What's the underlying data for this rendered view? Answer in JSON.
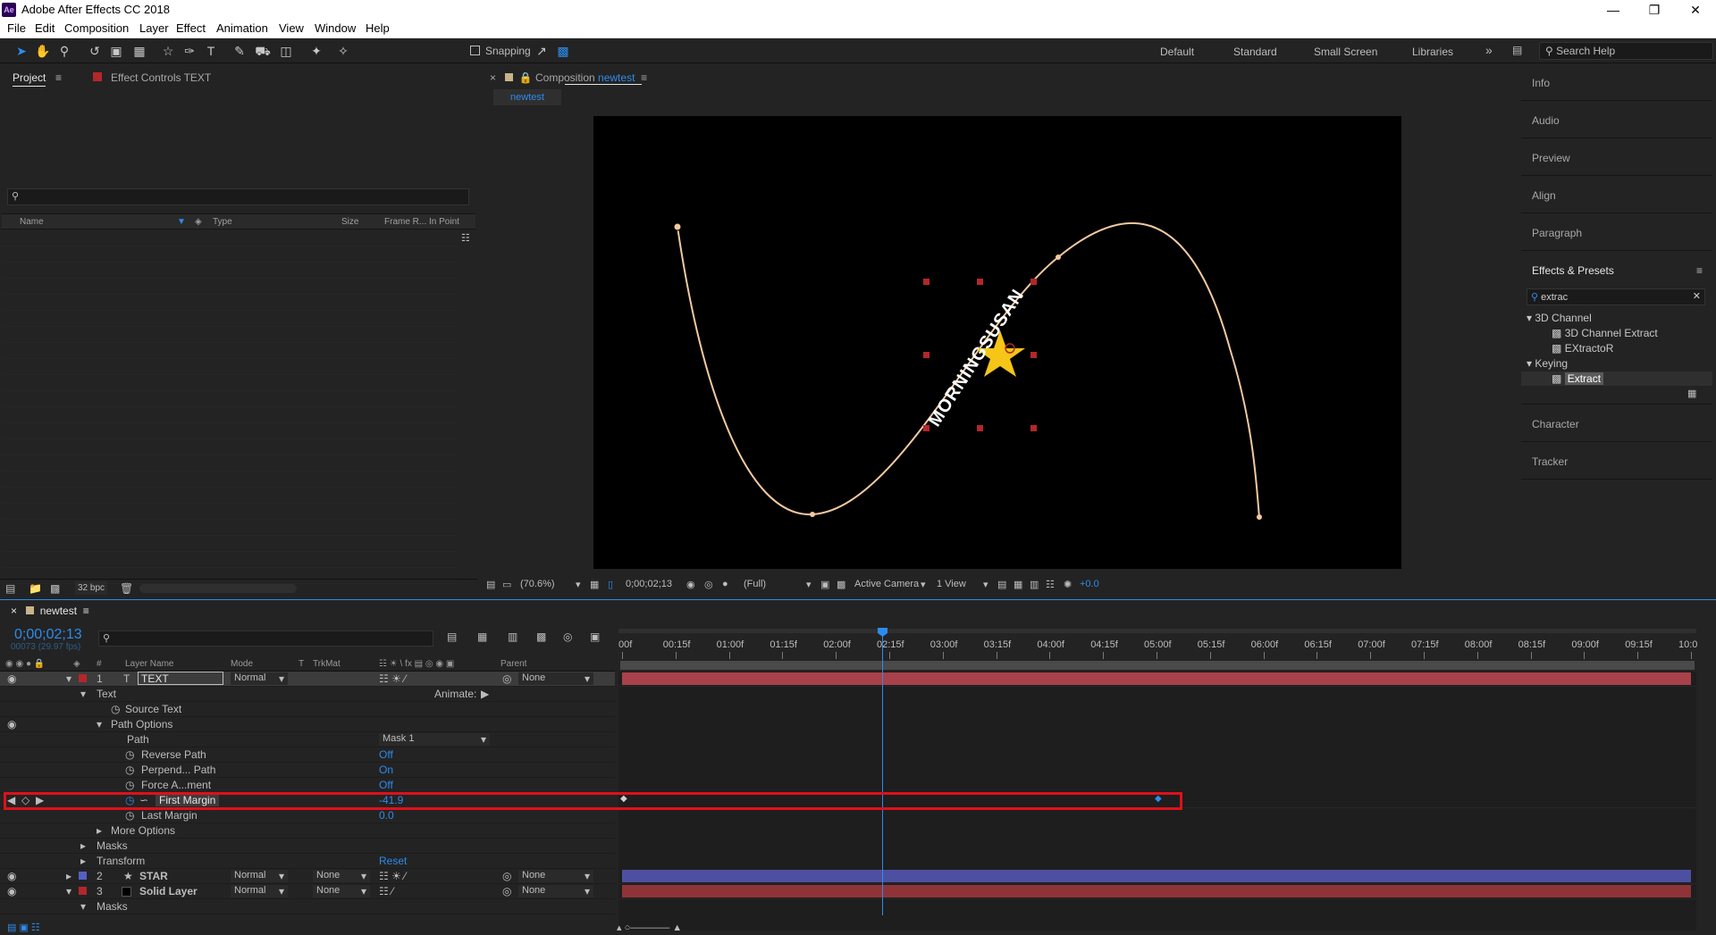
{
  "app": {
    "title": "Adobe After Effects CC 2018",
    "icon_label": "Ae"
  },
  "menu": [
    "File",
    "Edit",
    "Composition",
    "Layer",
    "Effect",
    "Animation",
    "View",
    "Window",
    "Help"
  ],
  "toolbar": {
    "snapping_label": "Snapping",
    "workspaces": [
      "Default",
      "Standard",
      "Small Screen",
      "Libraries"
    ],
    "search_placeholder": "Search Help"
  },
  "project": {
    "tab_project": "Project",
    "tab_effect_controls": "Effect Controls TEXT",
    "columns": [
      "Name",
      "Type",
      "Size",
      "Frame R...",
      "In Point"
    ],
    "bpc": "32 bpc"
  },
  "composition": {
    "tab_label": "Composition",
    "comp_name": "newtest",
    "sub_tab": "newtest",
    "path_text": "MORNINGSUSAN",
    "toolbar": {
      "zoom": "(70.6%)",
      "timecode": "0;00;02;13",
      "resolution": "(Full)",
      "camera": "Active Camera",
      "views": "1 View",
      "exposure": "+0.0"
    }
  },
  "right_panels": {
    "items": [
      "Info",
      "Audio",
      "Preview",
      "Align",
      "Paragraph",
      "Effects & Presets",
      "Character",
      "Tracker"
    ],
    "effects_search": "extrac",
    "tree": [
      {
        "category": "3D Channel",
        "items": [
          "3D Channel Extract",
          "EXtractoR"
        ]
      },
      {
        "category": "Keying",
        "items": [
          "Extract"
        ]
      }
    ]
  },
  "timeline": {
    "tab": "newtest",
    "timecode": "0;00;02;13",
    "frames": "00073 (29.97 fps)",
    "headers": {
      "layer_name": "Layer Name",
      "mode": "Mode",
      "t": "T",
      "trkmat": "TrkMat",
      "parent": "Parent",
      "num": "#"
    },
    "ruler": [
      "00f",
      "00:15f",
      "01:00f",
      "01:15f",
      "02:00f",
      "02:15f",
      "03:00f",
      "03:15f",
      "04:00f",
      "04:15f",
      "05:00f",
      "05:15f",
      "06:00f",
      "06:15f",
      "07:00f",
      "07:15f",
      "08:00f",
      "08:15f",
      "09:00f",
      "09:15f",
      "10:0"
    ],
    "current_frame_position": 2.4333,
    "layers": [
      {
        "num": "1",
        "name": "TEXT",
        "mode": "Normal",
        "trkmat": "",
        "parent": "None",
        "color": "#b3272b"
      },
      {
        "num": "2",
        "name": "STAR",
        "mode": "Normal",
        "trkmat": "None",
        "parent": "None",
        "color": "#5560c4"
      },
      {
        "num": "3",
        "name": "Solid Layer",
        "mode": "Normal",
        "trkmat": "None",
        "parent": "None",
        "color": "#b3272b"
      }
    ],
    "props": {
      "text": "Text",
      "animate": "Animate:",
      "source_text": "Source Text",
      "path_options": "Path Options",
      "path": "Path",
      "path_value": "Mask 1",
      "reverse_path": "Reverse Path",
      "reverse_path_value": "Off",
      "perpend_path": "Perpend... Path",
      "perpend_path_value": "On",
      "force_align": "Force A...ment",
      "force_align_value": "Off",
      "first_margin": "First Margin",
      "first_margin_value": "-41.9",
      "last_margin": "Last Margin",
      "last_margin_value": "0.0",
      "more_options": "More Options",
      "masks": "Masks",
      "transform": "Transform",
      "reset": "Reset",
      "masks2": "Masks"
    }
  }
}
